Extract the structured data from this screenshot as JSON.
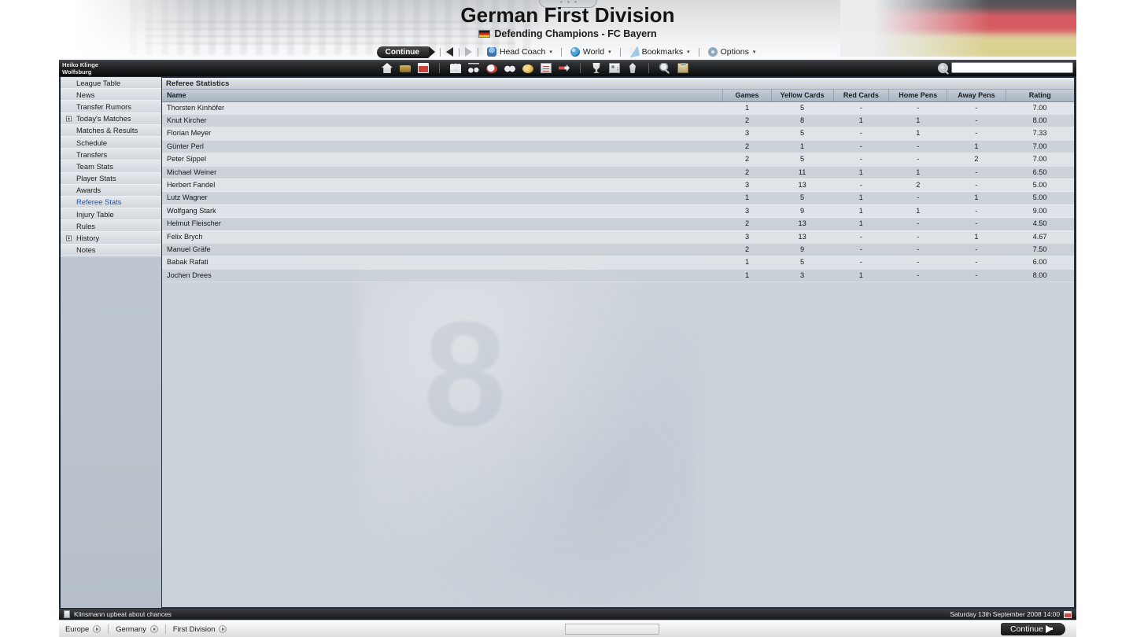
{
  "header": {
    "title": "German First Division",
    "subtitle": "Defending Champions - FC Bayern",
    "flag_icon": "german-flag-icon"
  },
  "menubar": {
    "continue_label": "Continue",
    "back_icon": "back-arrow-icon",
    "forward_icon": "forward-arrow-icon",
    "items": [
      {
        "label": "Head Coach",
        "icon": "head-coach-icon",
        "caret": "▾"
      },
      {
        "label": "World",
        "icon": "world-globe-icon",
        "caret": "▾"
      },
      {
        "label": "Bookmarks",
        "icon": "bookmarks-icon",
        "caret": "▾"
      },
      {
        "label": "Options",
        "icon": "options-gear-icon",
        "caret": "▾"
      }
    ]
  },
  "user": {
    "name": "Heiko Klinge",
    "club": "Wolfsburg"
  },
  "toolbar": {
    "icons": [
      "home-icon",
      "inbox-icon",
      "calendar-icon",
      "squad-icon",
      "tactics-icon",
      "ball-icon",
      "scouting-icon",
      "finances-icon",
      "news-icon",
      "transfers-icon",
      "competitions-trophy-icon",
      "player-profile-icon",
      "training-icon",
      "search-player-icon",
      "clipboard-icon"
    ]
  },
  "search": {
    "value": "",
    "placeholder": "",
    "icon": "search-icon"
  },
  "sidebar": {
    "items": [
      {
        "label": "League Table",
        "expandable": false,
        "selected": false
      },
      {
        "label": "News",
        "expandable": false,
        "selected": false
      },
      {
        "label": "Transfer Rumors",
        "expandable": false,
        "selected": false
      },
      {
        "label": "Today's Matches",
        "expandable": true,
        "selected": false
      },
      {
        "label": "Matches & Results",
        "expandable": false,
        "selected": false
      },
      {
        "label": "Schedule",
        "expandable": false,
        "selected": false
      },
      {
        "label": "Transfers",
        "expandable": false,
        "selected": false
      },
      {
        "label": "Team Stats",
        "expandable": false,
        "selected": false
      },
      {
        "label": "Player Stats",
        "expandable": false,
        "selected": false
      },
      {
        "label": "Awards",
        "expandable": false,
        "selected": false
      },
      {
        "label": "Referee Stats",
        "expandable": false,
        "selected": true
      },
      {
        "label": "Injury Table",
        "expandable": false,
        "selected": false
      },
      {
        "label": "Rules",
        "expandable": false,
        "selected": false
      },
      {
        "label": "History",
        "expandable": true,
        "selected": false
      },
      {
        "label": "Notes",
        "expandable": false,
        "selected": false
      }
    ]
  },
  "panel": {
    "title": "Referee Statistics",
    "columns": [
      "Name",
      "Games",
      "Yellow Cards",
      "Red Cards",
      "Home Pens",
      "Away Pens",
      "Rating"
    ],
    "rows": [
      {
        "name": "Thorsten Kinhöfer",
        "games": "1",
        "yellow": "5",
        "red": "-",
        "home_pens": "-",
        "away_pens": "-",
        "rating": "7.00"
      },
      {
        "name": "Knut Kircher",
        "games": "2",
        "yellow": "8",
        "red": "1",
        "home_pens": "1",
        "away_pens": "-",
        "rating": "8.00"
      },
      {
        "name": "Florian Meyer",
        "games": "3",
        "yellow": "5",
        "red": "-",
        "home_pens": "1",
        "away_pens": "-",
        "rating": "7.33"
      },
      {
        "name": "Günter Perl",
        "games": "2",
        "yellow": "1",
        "red": "-",
        "home_pens": "-",
        "away_pens": "1",
        "rating": "7.00"
      },
      {
        "name": "Peter Sippel",
        "games": "2",
        "yellow": "5",
        "red": "-",
        "home_pens": "-",
        "away_pens": "2",
        "rating": "7.00"
      },
      {
        "name": "Michael Weiner",
        "games": "2",
        "yellow": "11",
        "red": "1",
        "home_pens": "1",
        "away_pens": "-",
        "rating": "6.50"
      },
      {
        "name": "Herbert Fandel",
        "games": "3",
        "yellow": "13",
        "red": "-",
        "home_pens": "2",
        "away_pens": "-",
        "rating": "5.00"
      },
      {
        "name": "Lutz Wagner",
        "games": "1",
        "yellow": "5",
        "red": "1",
        "home_pens": "-",
        "away_pens": "1",
        "rating": "5.00"
      },
      {
        "name": "Wolfgang Stark",
        "games": "3",
        "yellow": "9",
        "red": "1",
        "home_pens": "1",
        "away_pens": "-",
        "rating": "9.00"
      },
      {
        "name": "Helmut Fleischer",
        "games": "2",
        "yellow": "13",
        "red": "1",
        "home_pens": "-",
        "away_pens": "-",
        "rating": "4.50"
      },
      {
        "name": "Felix Brych",
        "games": "3",
        "yellow": "13",
        "red": "-",
        "home_pens": "-",
        "away_pens": "1",
        "rating": "4.67"
      },
      {
        "name": "Manuel Gräfe",
        "games": "2",
        "yellow": "9",
        "red": "-",
        "home_pens": "-",
        "away_pens": "-",
        "rating": "7.50"
      },
      {
        "name": "Babak Rafati",
        "games": "1",
        "yellow": "5",
        "red": "-",
        "home_pens": "-",
        "away_pens": "-",
        "rating": "6.00"
      },
      {
        "name": "Jochen Drees",
        "games": "1",
        "yellow": "3",
        "red": "1",
        "home_pens": "-",
        "away_pens": "-",
        "rating": "8.00"
      }
    ]
  },
  "status": {
    "news_headline": "Klinsmann upbeat about chances",
    "date": "Saturday 13th September 2008 14:00",
    "calendar_icon": "calendar-icon"
  },
  "breadcrumb": {
    "items": [
      "Europe",
      "Germany",
      "First Division"
    ]
  },
  "footer": {
    "continue_label": "Continue"
  },
  "watermark": {
    "number": "8"
  }
}
